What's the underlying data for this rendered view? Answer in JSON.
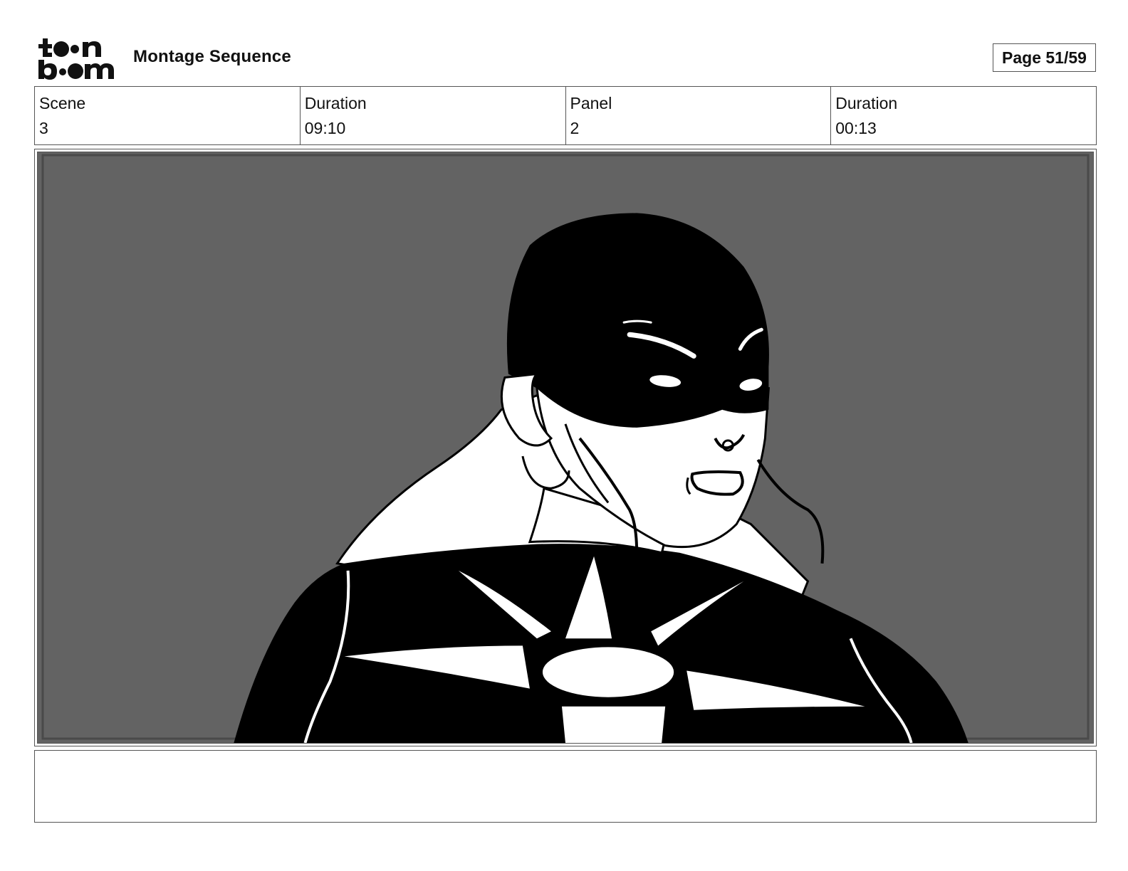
{
  "header": {
    "logo_alt": "toon boom",
    "title": "Montage Sequence",
    "page_label": "Page 51/59"
  },
  "info": [
    {
      "label": "Scene",
      "value": "3"
    },
    {
      "label": "Duration",
      "value": "09:10"
    },
    {
      "label": "Panel",
      "value": "2"
    },
    {
      "label": "Duration",
      "value": "00:13"
    }
  ],
  "panel": {
    "background_color": "#636363",
    "ink_color": "#000000",
    "paper_color": "#ffffff",
    "icon": "masked-heroine-drawing"
  },
  "notes": {
    "text": ""
  }
}
